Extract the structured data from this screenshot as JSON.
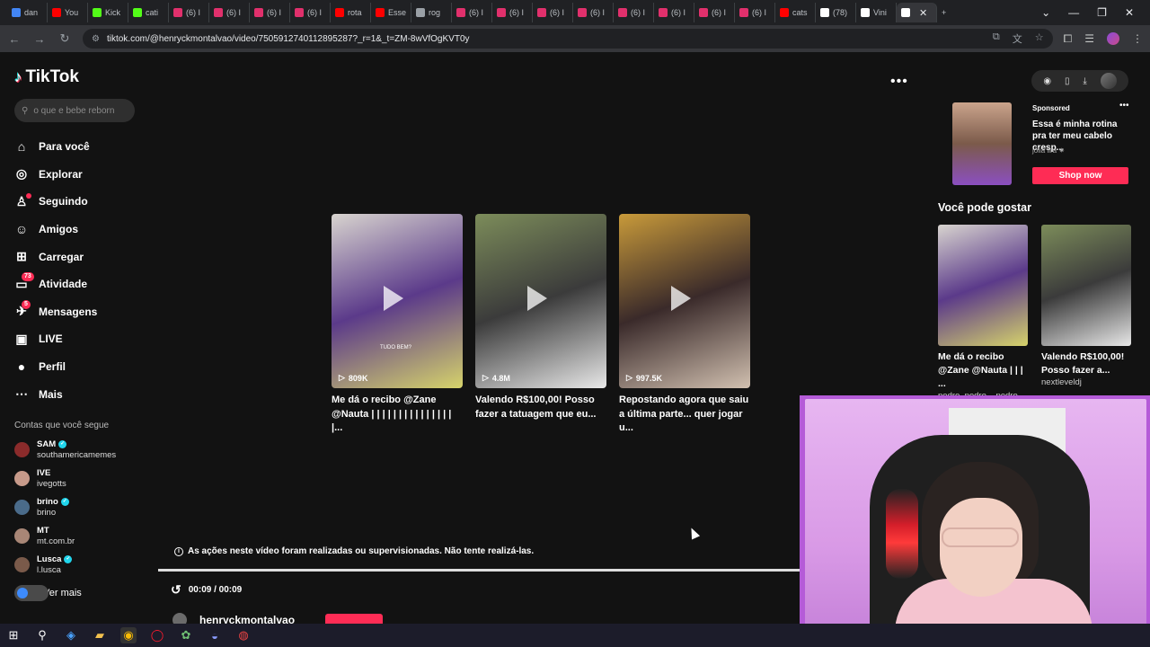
{
  "browser": {
    "tabs": [
      {
        "label": "dan",
        "color": "#4285f4"
      },
      {
        "label": "You",
        "color": "#ff0000"
      },
      {
        "label": "Kick",
        "color": "#53fc18"
      },
      {
        "label": "cati",
        "color": "#53fc18"
      },
      {
        "label": "(6) I",
        "color": "#e1306c"
      },
      {
        "label": "(6) I",
        "color": "#e1306c"
      },
      {
        "label": "(6) I",
        "color": "#e1306c"
      },
      {
        "label": "(6) I",
        "color": "#e1306c"
      },
      {
        "label": "rota",
        "color": "#ff0000"
      },
      {
        "label": "Esse",
        "color": "#ff0000"
      },
      {
        "label": "rog",
        "color": "#9aa0a6"
      },
      {
        "label": "(6) I",
        "color": "#e1306c"
      },
      {
        "label": "(6) I",
        "color": "#e1306c"
      },
      {
        "label": "(6) I",
        "color": "#e1306c"
      },
      {
        "label": "(6) I",
        "color": "#e1306c"
      },
      {
        "label": "(6) I",
        "color": "#e1306c"
      },
      {
        "label": "(6) I",
        "color": "#e1306c"
      },
      {
        "label": "(6) I",
        "color": "#e1306c"
      },
      {
        "label": "(6) I",
        "color": "#e1306c"
      },
      {
        "label": "cats",
        "color": "#ff0000"
      },
      {
        "label": "(78)",
        "color": "#ffffff"
      },
      {
        "label": "Vini",
        "color": "#ffffff"
      }
    ],
    "url": "tiktok.com/@henryckmontalvao/video/7505912740112895287?_r=1&_t=ZM-8wVfOgKVT0y"
  },
  "tiktok": {
    "logo_text": "TikTok",
    "search_placeholder": "o que e bebe reborn",
    "nav": [
      {
        "label": "Para você",
        "icon": "home-icon",
        "glyph": "⌂"
      },
      {
        "label": "Explorar",
        "icon": "compass-icon",
        "glyph": "◎"
      },
      {
        "label": "Seguindo",
        "icon": "following-icon",
        "glyph": "♙"
      },
      {
        "label": "Amigos",
        "icon": "friends-icon",
        "glyph": "☺"
      },
      {
        "label": "Carregar",
        "icon": "upload-icon",
        "glyph": "⊞"
      },
      {
        "label": "Atividade",
        "icon": "activity-icon",
        "glyph": "▭",
        "badge": "73"
      },
      {
        "label": "Mensagens",
        "icon": "messages-icon",
        "glyph": "✈",
        "badge": "5"
      },
      {
        "label": "LIVE",
        "icon": "live-icon",
        "glyph": "▣"
      },
      {
        "label": "Perfil",
        "icon": "profile-icon",
        "glyph": "●"
      },
      {
        "label": "Mais",
        "icon": "more-icon",
        "glyph": "⋯"
      }
    ],
    "following_title": "Contas que você segue",
    "following": [
      {
        "name": "SAM",
        "handle": "southamericamemes",
        "verified": true,
        "color": "#8b2b2b"
      },
      {
        "name": "IVE",
        "handle": "ivegotts",
        "verified": false,
        "color": "#c79a8a"
      },
      {
        "name": "brino",
        "handle": "brino",
        "verified": true,
        "color": "#4a6b8a"
      },
      {
        "name": "MT",
        "handle": "mt.com.br",
        "verified": false,
        "color": "#a88676"
      },
      {
        "name": "Lusca",
        "handle": "l.lusca",
        "verified": true,
        "color": "#7a5a4a"
      }
    ],
    "see_more": "Ver mais",
    "videos": [
      {
        "views": "809K",
        "caption": "Me dá o recibo @Zane @Nauta | | | | | | | | | | | | | | | |...",
        "overlay": "TUDO BEM?",
        "colors": [
          "#d8d4cf",
          "#5b3a8a",
          "#d6d36b"
        ]
      },
      {
        "views": "4.8M",
        "caption": "Valendo R$100,00! Posso fazer a tatuagem que eu...",
        "overlay": "",
        "colors": [
          "#7c8c5a",
          "#3b3b3b",
          "#e8e8e8"
        ]
      },
      {
        "views": "997.5K",
        "caption": "Repostando agora que saiu a última parte... quer jogar u...",
        "overlay": "",
        "colors": [
          "#c89a3a",
          "#3a2a2a",
          "#d1c0b0"
        ]
      }
    ],
    "notice": "As ações neste vídeo foram realizadas ou supervisionadas. Não tente realizá-las.",
    "time": "00:09 / 00:09",
    "author": "henryckmontalvao",
    "ad": {
      "sponsored": "Sponsored",
      "title": "Essa é minha rotina pra ter meu cabelo cresp...",
      "brand": "jôlia lira ✷",
      "cta": "Shop now"
    },
    "you_may_like": "Você pode gostar",
    "recommendations": [
      {
        "caption": "Me dá o recibo @Zane @Nauta | | | ...",
        "author": "pedro_pedro__pedro_...",
        "colors": [
          "#d8d4cf",
          "#5b3a8a",
          "#d6d36b"
        ]
      },
      {
        "caption": "Valendo R$100,00! Posso fazer a...",
        "author": "nextleveldj",
        "colors": [
          "#7c8c5a",
          "#3b3b3b",
          "#e8e8e8"
        ]
      }
    ]
  }
}
